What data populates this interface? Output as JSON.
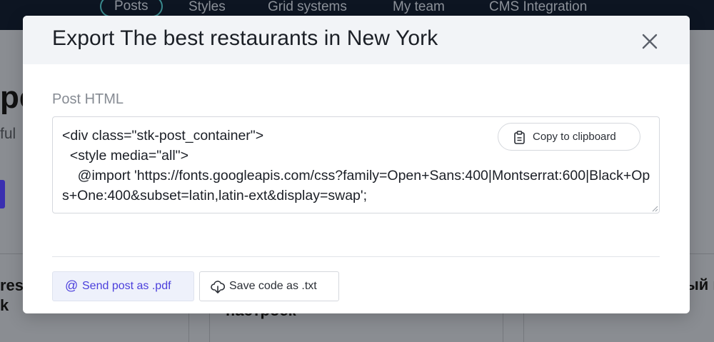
{
  "background": {
    "nav": {
      "items": [
        "Posts",
        "Styles",
        "Grid systems",
        "My team",
        "CMS Integration"
      ],
      "active": "Posts"
    },
    "heading_fragment": "pe",
    "subtitle_fragment": "ful",
    "cards": [
      {
        "text": "res\nk"
      },
      {
        "text": "настроек"
      },
      {
        "text": "ый п"
      }
    ]
  },
  "modal": {
    "title": "Export The best restaurants in New York",
    "field_label": "Post HTML",
    "code": "<div class=\"stk-post_container\">\n  <style media=\"all\">\n    @import 'https://fonts.googleapis.com/css?family=Open+Sans:400|Montserrat:600|Black+Ops+One:400&subset=latin,latin-ext&display=swap';",
    "copy_button": {
      "label": "Copy to clipboard",
      "icon": "clipboard-icon"
    },
    "pdf_button": {
      "label": "Send post as .pdf",
      "icon": "at-icon"
    },
    "txt_button": {
      "label": "Save code as .txt",
      "icon": "cloud-download-icon"
    },
    "close_icon": "close-icon"
  },
  "colors": {
    "accent": "#4b3fdc",
    "header_bg": "#f2f4f7",
    "nav_bg": "#0d1522"
  }
}
